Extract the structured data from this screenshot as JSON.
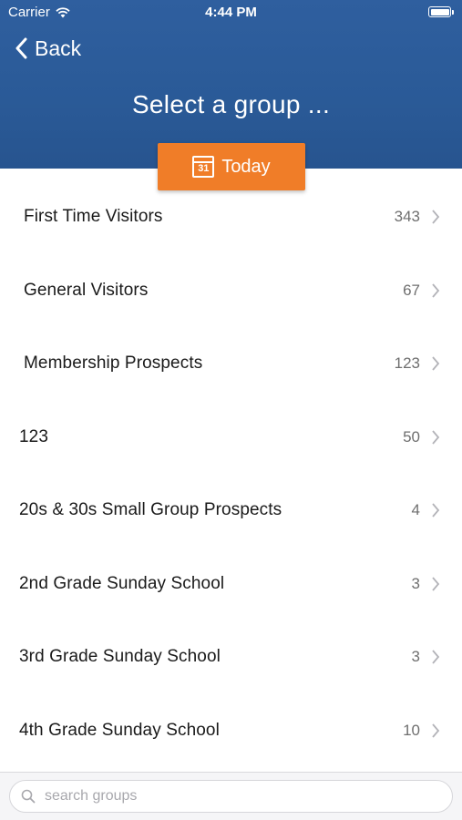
{
  "status_bar": {
    "carrier": "Carrier",
    "time": "4:44 PM"
  },
  "nav": {
    "back_label": "Back",
    "title": "Select a group ..."
  },
  "today_button": {
    "label": "Today",
    "calendar_day": "31"
  },
  "groups": [
    {
      "name": "First Time Visitors",
      "count": "343"
    },
    {
      "name": "General Visitors",
      "count": "67"
    },
    {
      "name": "Membership Prospects",
      "count": "123"
    },
    {
      "name": "123",
      "count": "50"
    },
    {
      "name": "20s & 30s Small Group Prospects",
      "count": "4"
    },
    {
      "name": "2nd Grade Sunday School",
      "count": "3"
    },
    {
      "name": "3rd Grade Sunday School",
      "count": "3"
    },
    {
      "name": "4th Grade Sunday School",
      "count": "10"
    }
  ],
  "search": {
    "placeholder": "search groups",
    "value": ""
  },
  "colors": {
    "header": "#2a5a97",
    "accent": "#f07d28"
  }
}
